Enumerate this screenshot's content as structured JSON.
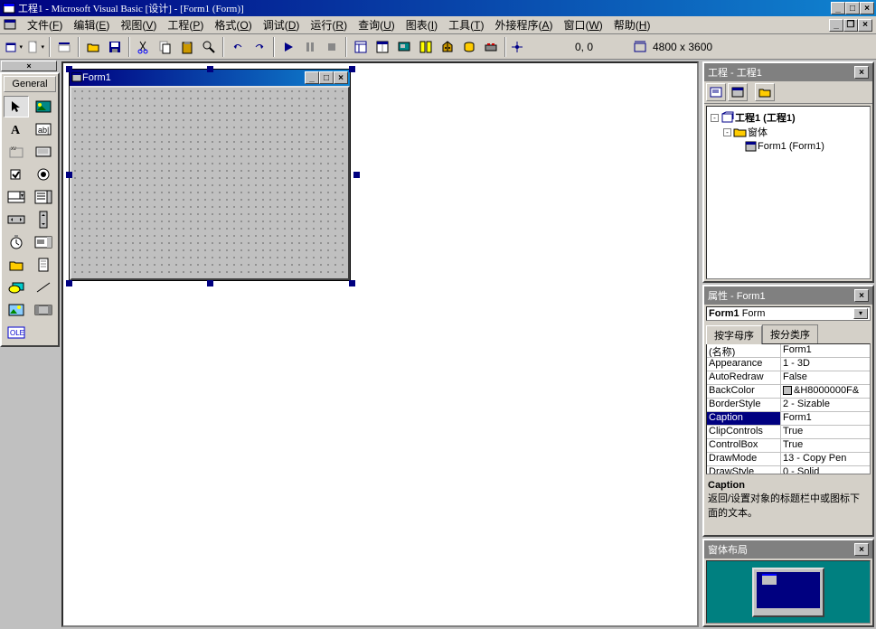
{
  "app": {
    "title": "工程1 - Microsoft Visual Basic [设计] - [Form1 (Form)]"
  },
  "menu": {
    "items": [
      {
        "label": "文件",
        "key": "F"
      },
      {
        "label": "编辑",
        "key": "E"
      },
      {
        "label": "视图",
        "key": "V"
      },
      {
        "label": "工程",
        "key": "P"
      },
      {
        "label": "格式",
        "key": "O"
      },
      {
        "label": "调试",
        "key": "D"
      },
      {
        "label": "运行",
        "key": "R"
      },
      {
        "label": "查询",
        "key": "U"
      },
      {
        "label": "图表",
        "key": "I"
      },
      {
        "label": "工具",
        "key": "T"
      },
      {
        "label": "外接程序",
        "key": "A"
      },
      {
        "label": "窗口",
        "key": "W"
      },
      {
        "label": "帮助",
        "key": "H"
      }
    ]
  },
  "toolbar": {
    "coords": "0, 0",
    "size": "4800 x 3600"
  },
  "toolbox": {
    "title": "General"
  },
  "form": {
    "title": "Form1"
  },
  "project_panel": {
    "title": "工程 - 工程1",
    "tree": {
      "root": "工程1 (工程1)",
      "folder": "窗体",
      "item": "Form1 (Form1)"
    }
  },
  "props_panel": {
    "title": "属性 - Form1",
    "object": "Form1",
    "object_type": "Form",
    "tabs": {
      "alpha": "按字母序",
      "category": "按分类序"
    },
    "rows": [
      {
        "name": "(名称)",
        "value": "Form1"
      },
      {
        "name": "Appearance",
        "value": "1 - 3D"
      },
      {
        "name": "AutoRedraw",
        "value": "False"
      },
      {
        "name": "BackColor",
        "value": "&H8000000F&"
      },
      {
        "name": "BorderStyle",
        "value": "2 - Sizable"
      },
      {
        "name": "Caption",
        "value": "Form1",
        "selected": true
      },
      {
        "name": "ClipControls",
        "value": "True"
      },
      {
        "name": "ControlBox",
        "value": "True"
      },
      {
        "name": "DrawMode",
        "value": "13 - Copy Pen"
      },
      {
        "name": "DrawStyle",
        "value": "0 - Solid"
      }
    ],
    "desc": {
      "name": "Caption",
      "text": "返回/设置对象的标题栏中或图标下面的文本。"
    }
  },
  "layout_panel": {
    "title": "窗体布局"
  }
}
